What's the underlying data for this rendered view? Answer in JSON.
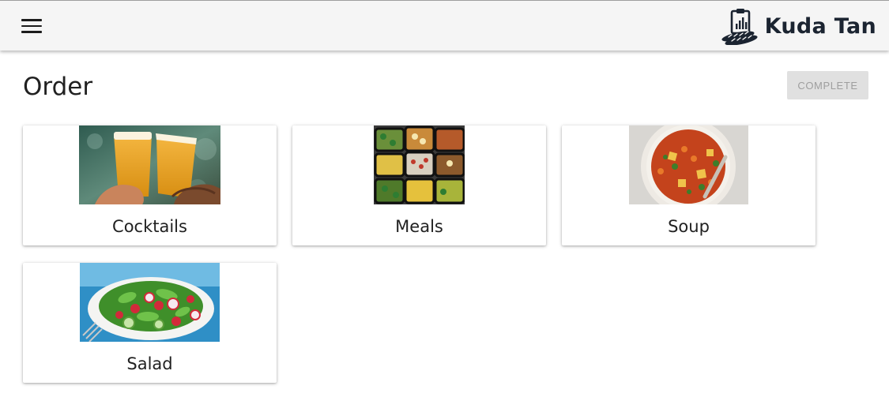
{
  "header": {
    "brand_name": "Kuda Tan",
    "menu_icon": "hamburger-menu-icon",
    "logo_icon": "clipboard-chart-bread-logo"
  },
  "page": {
    "title": "Order",
    "complete_label": "COMPLETE"
  },
  "categories": [
    {
      "label": "Cocktails",
      "image": "two-beer-glasses-toast-image"
    },
    {
      "label": "Meals",
      "image": "meal-prep-containers-image"
    },
    {
      "label": "Soup",
      "image": "vegetable-soup-bowl-image"
    },
    {
      "label": "Salad",
      "image": "fresh-salad-plate-image"
    }
  ],
  "colors": {
    "app_bar": "#f5f5f5",
    "brand_text": "#1b2431",
    "button_disabled_bg": "#e0e0e0",
    "button_disabled_text": "#9e9e9e"
  }
}
